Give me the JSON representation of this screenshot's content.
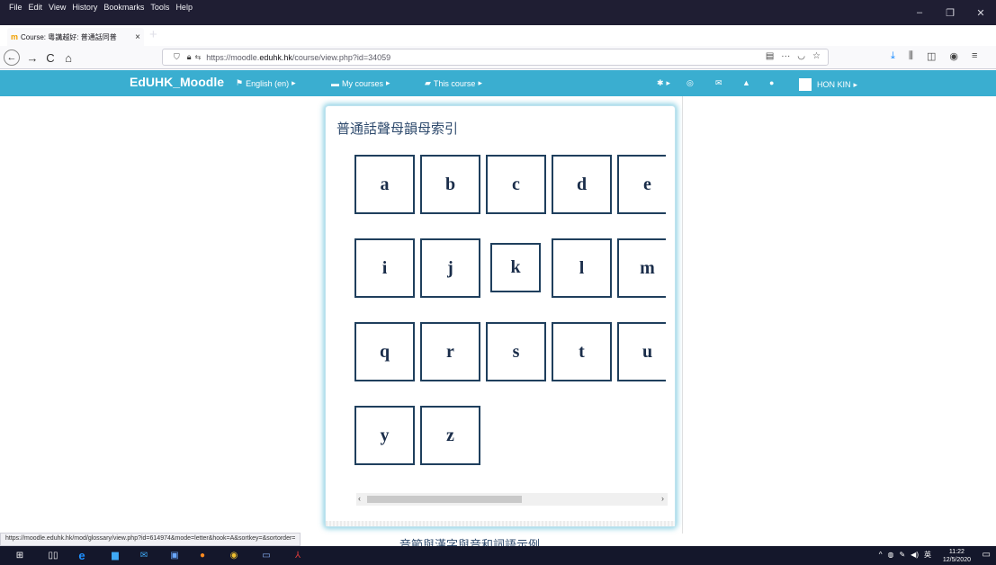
{
  "menubar": {
    "items": [
      "File",
      "Edit",
      "View",
      "History",
      "Bookmarks",
      "Tools",
      "Help"
    ]
  },
  "tab": {
    "title": "Course: 粵講越好: 普通話同普",
    "close": "×",
    "new_tab": "+"
  },
  "nav": {
    "back": "←",
    "forward": "→",
    "reload": "C",
    "home": "⌂",
    "url_prefix": "https://moodle.",
    "url_domain": "eduhk.hk",
    "url_path": "/course/view.php?id=34059",
    "more": "···"
  },
  "moodle": {
    "brand": "EdUHK_Moodle",
    "language": "English (en)",
    "my_courses": "My courses",
    "this_course": "This course",
    "user": "HON KIN"
  },
  "glossary": {
    "heading": "普通話聲母韻母索引",
    "letters": [
      "a",
      "b",
      "c",
      "d",
      "e",
      "i",
      "j",
      "k",
      "l",
      "m",
      "q",
      "r",
      "s",
      "t",
      "u",
      "y",
      "z"
    ],
    "scroll_left": "‹",
    "scroll_right": "›"
  },
  "below_text": "音節與漢字與音和詞語示例",
  "status_url": "https://moodle.eduhk.hk/mod/glossary/view.php?id=614974&mode=letter&hook=A&sortkey=&sortorder=",
  "taskbar": {
    "ime": "英",
    "time": "11:22",
    "date": "12/5/2020"
  },
  "colors": {
    "moodle_bar": "#3aaed0",
    "cell_border": "#1f3f5d",
    "heading": "#2e4a6d"
  }
}
